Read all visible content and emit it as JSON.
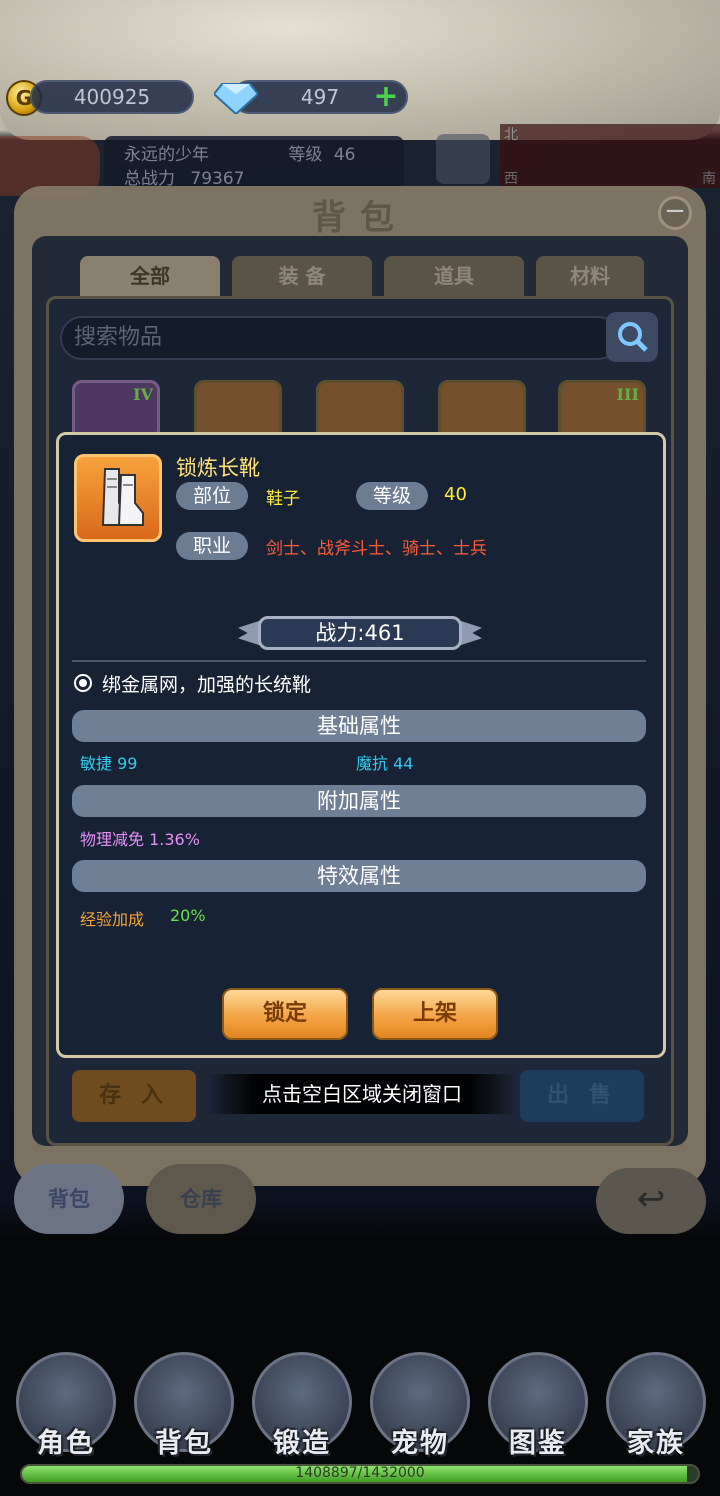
{
  "resources": {
    "gold": "400925",
    "gems": "497"
  },
  "player": {
    "name": "永远的少年",
    "level_label": "等级",
    "level": "46",
    "power_label": "总战力",
    "power": "79367"
  },
  "map": {
    "north": "北",
    "west": "西",
    "south": "南"
  },
  "bag": {
    "title": "背包",
    "tabs": [
      "全部",
      "装 备",
      "道具",
      "材料"
    ],
    "search_placeholder": "搜索物品",
    "slot_badges": [
      "IV",
      "III"
    ],
    "store_in_label": "存 入",
    "sell_label": "出 售",
    "hint": "点击空白区域关闭窗口",
    "nav_bag": "背包",
    "nav_warehouse": "仓库"
  },
  "item": {
    "name": "锁炼长靴",
    "slot_label": "部位",
    "slot_value": "鞋子",
    "level_label": "等级",
    "level_value": "40",
    "class_label": "职业",
    "class_value": "剑士、战斧斗士、骑士、士兵",
    "power": "战力:461",
    "description": "绑金属网，加强的长统靴",
    "sections": {
      "base": "基础属性",
      "extra": "附加属性",
      "special": "特效属性"
    },
    "stats": {
      "agility": "敏捷 99",
      "magic_resist": "魔抗 44",
      "phys_reduction": "物理减免 1.36%",
      "exp_label": "经验加成",
      "exp_value": "20%"
    },
    "buttons": {
      "lock": "锁定",
      "list": "上架"
    }
  },
  "main_nav": [
    "角色",
    "背包",
    "锻造",
    "宠物",
    "图鉴",
    "家族"
  ],
  "exp": {
    "text": "1408897/1432000",
    "fraction": 0.984
  },
  "colors": {
    "gold": "#ffe07a",
    "stat_base": "#35c8e8",
    "stat_extra": "#e38ff3",
    "stat_special": "#f3a33a",
    "class_text": "#ff5a3a",
    "button_orange": "#f4a545"
  }
}
